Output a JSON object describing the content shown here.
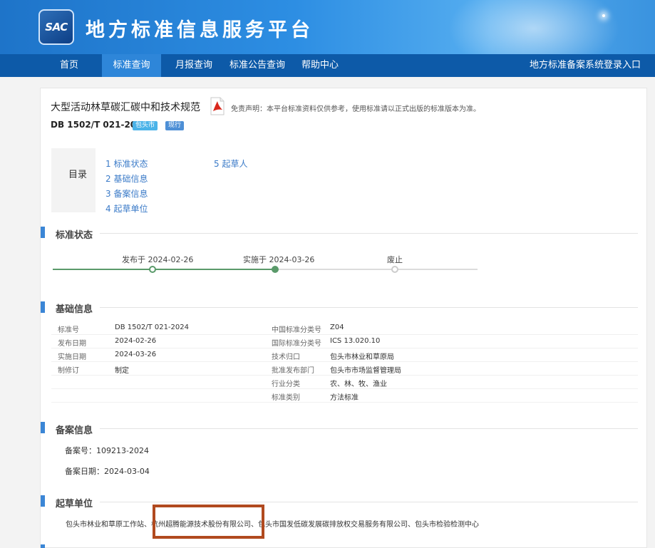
{
  "header": {
    "logo_text": "SAC",
    "site_title": "地方标准信息服务平台"
  },
  "nav": {
    "items": [
      {
        "label": "首页"
      },
      {
        "label": "标准查询"
      },
      {
        "label": "月报查询"
      },
      {
        "label": "标准公告查询"
      },
      {
        "label": "帮助中心"
      }
    ],
    "active_index": 1,
    "login_label": "地方标准备案系统登录入口"
  },
  "standard": {
    "title": "大型活动林草碳汇碳中和技术规范",
    "disclaimer": "免责声明：本平台标准资料仅供参考，使用标准请以正式出版的标准版本为准。",
    "code": "DB 1502/T 021-2024",
    "city_badge": "包头市",
    "status_badge": "现行"
  },
  "toc": {
    "label": "目录",
    "items": [
      "1 标准状态",
      "2 基础信息",
      "3 备案信息",
      "4 起草单位",
      "5 起草人"
    ]
  },
  "sections": {
    "status": "标准状态",
    "basic": "基础信息",
    "filing": "备案信息",
    "drafters": "起草单位"
  },
  "timeline": {
    "published": "发布于 2024-02-26",
    "implemented": "实施于 2024-03-26",
    "abolished": "废止"
  },
  "basic_info": {
    "left": [
      {
        "key": "标准号",
        "value": "DB 1502/T 021-2024"
      },
      {
        "key": "发布日期",
        "value": "2024-02-26"
      },
      {
        "key": "实施日期",
        "value": "2024-03-26"
      },
      {
        "key": "制修订",
        "value": "制定"
      }
    ],
    "right": [
      {
        "key": "中国标准分类号",
        "value": "Z04"
      },
      {
        "key": "国际标准分类号",
        "value": "ICS 13.020.10"
      },
      {
        "key": "技术归口",
        "value": "包头市林业和草原局"
      },
      {
        "key": "批准发布部门",
        "value": "包头市市场监督管理局"
      },
      {
        "key": "行业分类",
        "value": "农、林、牧、渔业"
      },
      {
        "key": "标准类别",
        "value": "方法标准"
      }
    ]
  },
  "filing": {
    "number": "备案号：109213-2024",
    "date": "备案日期：2024-03-04"
  },
  "drafters": {
    "text": "包头市林业和草原工作站、杭州超腾能源技术股份有限公司、包头市国发低碳发展碳排放权交易服务有限公司、包头市检验检测中心"
  },
  "colors": {
    "nav_bg": "#0d5aa8",
    "nav_active": "#2e86d9",
    "accent": "#3b86d6",
    "timeline_done": "#5a9a6a",
    "highlight": "#b14a1f"
  }
}
